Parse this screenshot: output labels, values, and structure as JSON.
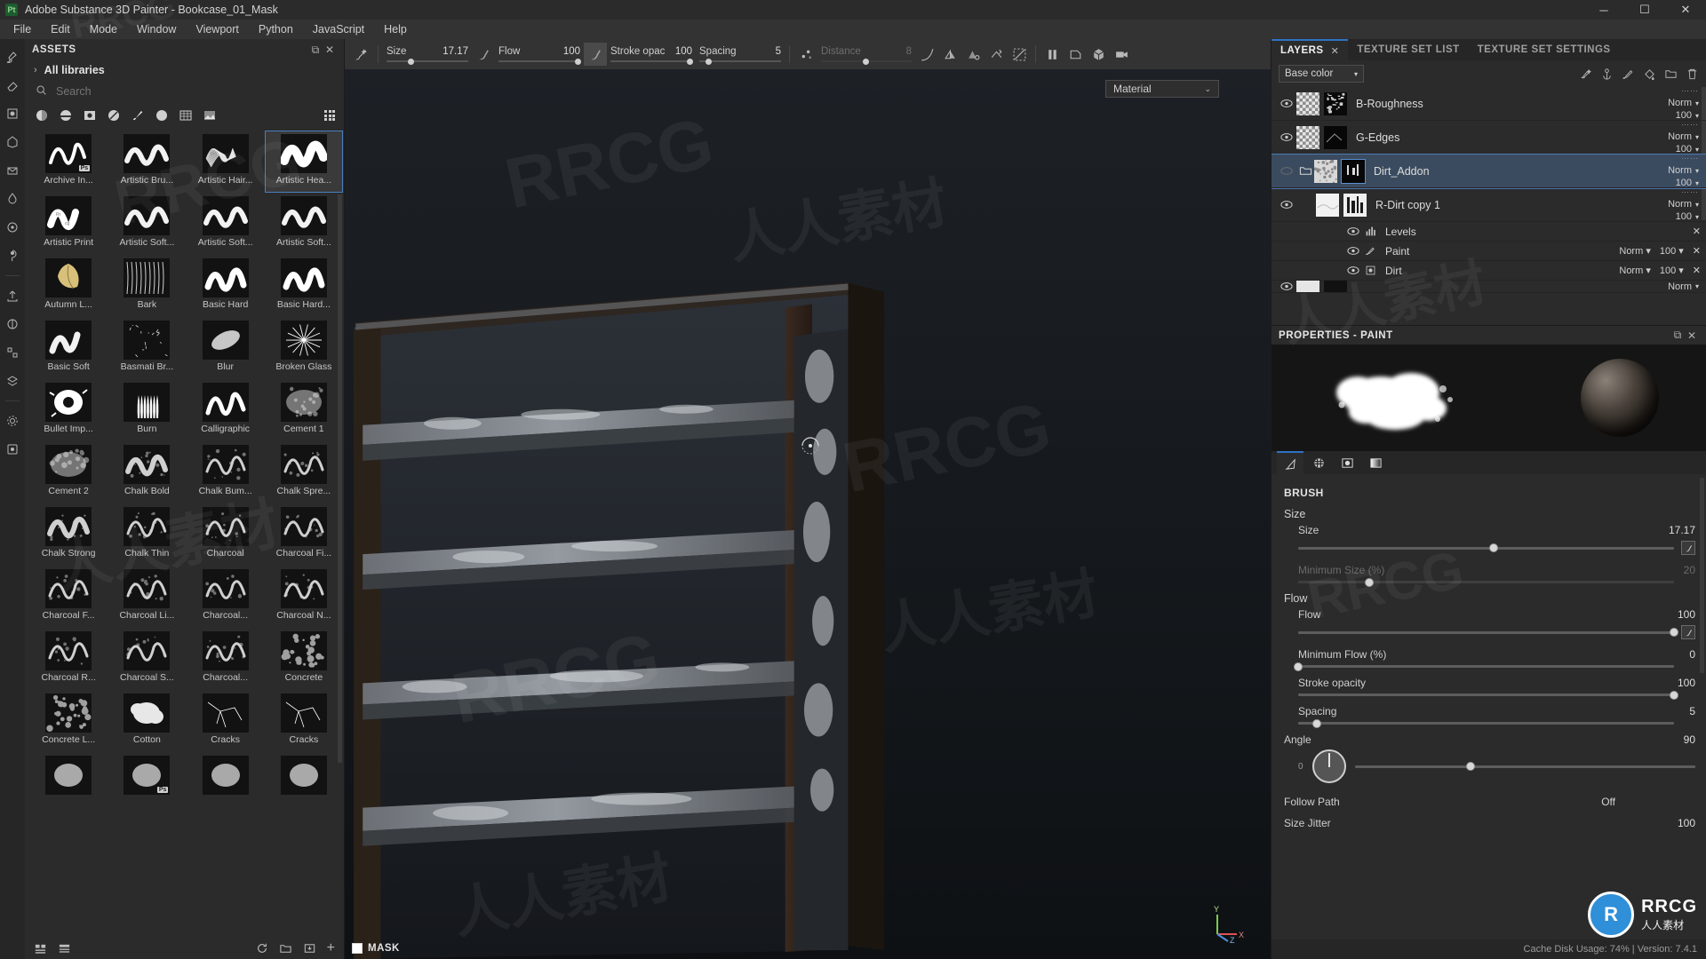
{
  "titlebar": {
    "app_icon": "photoshop-style-pt-icon",
    "title": "Adobe Substance 3D Painter - Bookcase_01_Mask",
    "minimize": "─",
    "maximize": "☐",
    "close": "✕"
  },
  "menubar": {
    "items": [
      "File",
      "Edit",
      "Mode",
      "Window",
      "Viewport",
      "Python",
      "JavaScript",
      "Help"
    ]
  },
  "left_rail": {
    "icons": [
      "brush-icon",
      "eraser-icon",
      "projection-icon",
      "geometry-fill-icon",
      "polygon-fill-icon",
      "smudge-icon",
      "clone-icon",
      "material-picker-icon",
      "export-icon",
      "bake-icon",
      "generator-icon",
      "layer-stack-icon",
      "settings-icon",
      "plugin-icon"
    ]
  },
  "assets": {
    "panel_title": "ASSETS",
    "float_icon": "⧉",
    "close_icon": "✕",
    "library_label": "All libraries",
    "chevron": "›",
    "search_placeholder": "Search",
    "search_value": "",
    "filters": [
      "material-filter",
      "smart-material-filter",
      "mask-filter",
      "smart-mask-filter",
      "brush-filter",
      "alpha-filter",
      "texture-filter",
      "environment-filter"
    ],
    "grid_view_icon": "grid-view-icon",
    "items": [
      {
        "name": "Archive In...",
        "type": "stroke-thin",
        "badge": "Ps",
        "selected": false
      },
      {
        "name": "Artistic Bru...",
        "type": "stroke-soft",
        "badge": "",
        "selected": false
      },
      {
        "name": "Artistic Hair...",
        "type": "stroke-hair",
        "badge": "",
        "selected": false
      },
      {
        "name": "Artistic Hea...",
        "type": "stroke-heavy",
        "badge": "",
        "selected": true
      },
      {
        "name": "Artistic Print",
        "type": "stroke-print",
        "badge": "",
        "selected": false
      },
      {
        "name": "Artistic Soft...",
        "type": "stroke-soft2",
        "badge": "",
        "selected": false
      },
      {
        "name": "Artistic Soft...",
        "type": "stroke-soft3",
        "badge": "",
        "selected": false
      },
      {
        "name": "Artistic Soft...",
        "type": "stroke-soft4",
        "badge": "",
        "selected": false
      },
      {
        "name": "Autumn L...",
        "type": "leaf",
        "badge": "",
        "selected": false
      },
      {
        "name": "Bark",
        "type": "bark",
        "badge": "",
        "selected": false
      },
      {
        "name": "Basic Hard",
        "type": "basic-hard",
        "badge": "",
        "selected": false
      },
      {
        "name": "Basic Hard...",
        "type": "basic-hard2",
        "badge": "",
        "selected": false
      },
      {
        "name": "Basic Soft",
        "type": "basic-soft",
        "badge": "",
        "selected": false
      },
      {
        "name": "Basmati Br...",
        "type": "basmati",
        "badge": "",
        "selected": false
      },
      {
        "name": "Blur",
        "type": "blur",
        "badge": "",
        "selected": false
      },
      {
        "name": "Broken Glass",
        "type": "broken-glass",
        "badge": "",
        "selected": false
      },
      {
        "name": "Bullet Imp...",
        "type": "bullet",
        "badge": "",
        "selected": false
      },
      {
        "name": "Burn",
        "type": "burn",
        "badge": "",
        "selected": false
      },
      {
        "name": "Calligraphic",
        "type": "calligraphic",
        "badge": "",
        "selected": false
      },
      {
        "name": "Cement 1",
        "type": "cement1",
        "badge": "",
        "selected": false
      },
      {
        "name": "Cement 2",
        "type": "cement2",
        "badge": "",
        "selected": false
      },
      {
        "name": "Chalk Bold",
        "type": "chalk-bold",
        "badge": "",
        "selected": false
      },
      {
        "name": "Chalk Bum...",
        "type": "chalk-bump",
        "badge": "",
        "selected": false
      },
      {
        "name": "Chalk Spre...",
        "type": "chalk-spread",
        "badge": "",
        "selected": false
      },
      {
        "name": "Chalk Strong",
        "type": "chalk-strong",
        "badge": "",
        "selected": false
      },
      {
        "name": "Chalk Thin",
        "type": "chalk-thin",
        "badge": "",
        "selected": false
      },
      {
        "name": "Charcoal",
        "type": "charcoal",
        "badge": "",
        "selected": false
      },
      {
        "name": "Charcoal Fi...",
        "type": "charcoal-fine",
        "badge": "",
        "selected": false
      },
      {
        "name": "Charcoal F...",
        "type": "charcoal-f",
        "badge": "",
        "selected": false
      },
      {
        "name": "Charcoal Li...",
        "type": "charcoal-li",
        "badge": "",
        "selected": false
      },
      {
        "name": "Charcoal...",
        "type": "charcoal-3",
        "badge": "",
        "selected": false
      },
      {
        "name": "Charcoal N...",
        "type": "charcoal-n",
        "badge": "",
        "selected": false
      },
      {
        "name": "Charcoal R...",
        "type": "charcoal-r",
        "badge": "",
        "selected": false
      },
      {
        "name": "Charcoal S...",
        "type": "charcoal-s",
        "badge": "",
        "selected": false
      },
      {
        "name": "Charcoal...",
        "type": "charcoal-4",
        "badge": "",
        "selected": false
      },
      {
        "name": "Concrete",
        "type": "concrete",
        "badge": "",
        "selected": false
      },
      {
        "name": "Concrete L...",
        "type": "concrete-l",
        "badge": "",
        "selected": false
      },
      {
        "name": "Cotton",
        "type": "cotton",
        "badge": "",
        "selected": false
      },
      {
        "name": "Cracks",
        "type": "cracks",
        "badge": "",
        "selected": false
      },
      {
        "name": "Cracks",
        "type": "cracks2",
        "badge": "",
        "selected": false
      },
      {
        "name": "",
        "type": "row11a",
        "badge": "",
        "selected": false
      },
      {
        "name": "",
        "type": "row11b",
        "badge": "Ps",
        "selected": false
      },
      {
        "name": "",
        "type": "row11c",
        "badge": "",
        "selected": false
      },
      {
        "name": "",
        "type": "row11d",
        "badge": "",
        "selected": false
      }
    ],
    "footer_icons": [
      "list-view-icon",
      "shelf-icon",
      "refresh-icon",
      "folder-icon",
      "import-icon",
      "add-icon"
    ]
  },
  "toolbar": {
    "tool_icons": [
      "brush-cursor-icon",
      "close-tool-icon",
      "symmetry-icon"
    ],
    "params": [
      {
        "label": "Size",
        "value": "17.17",
        "knob_pct": 26,
        "dim": false,
        "pen": true
      },
      {
        "label": "Flow",
        "value": "100",
        "knob_pct": 94,
        "dim": false,
        "pen": true
      },
      {
        "label": "Stroke opac",
        "value": "100",
        "knob_pct": 94,
        "dim": false,
        "pen": false
      },
      {
        "label": "Spacing",
        "value": "5",
        "knob_pct": 8,
        "dim": false,
        "pen": false
      },
      {
        "label": "Distance",
        "value": "8",
        "knob_pct": 46,
        "dim": true,
        "pen": false
      }
    ],
    "right_icons": [
      "curve-icon",
      "mirror-icon",
      "mirror-plane-icon",
      "flip-icon",
      "no-symmetry-icon",
      "pause-icon",
      "camera-view-icon",
      "cube-3d-icon",
      "render-icon"
    ]
  },
  "viewport": {
    "material_dropdown": "Material",
    "dropdown_caret": "⌄",
    "mask_label": "MASK",
    "axis_labels": {
      "x": "X",
      "y": "Y",
      "z": "Z"
    }
  },
  "right_dock": {
    "tabs": [
      {
        "label": "LAYERS",
        "active": true,
        "closable": true,
        "close": "✕"
      },
      {
        "label": "TEXTURE SET LIST",
        "active": false,
        "closable": false
      },
      {
        "label": "TEXTURE SET SETTINGS",
        "active": false,
        "closable": false
      }
    ],
    "channel_dropdown": "Base color",
    "layer_tool_icons": [
      "add-effect-icon",
      "anchor-icon",
      "paint-layer-icon",
      "fill-layer-icon",
      "folder-icon",
      "trash-icon"
    ],
    "layers": [
      {
        "name": "B-Roughness",
        "visible": true,
        "selected": false,
        "blend": "Norm",
        "opacity": "100",
        "has_folder": false,
        "thumbs": [
          "checker",
          "mask-dark"
        ],
        "indent": 0
      },
      {
        "name": "G-Edges",
        "visible": true,
        "selected": false,
        "blend": "Norm",
        "opacity": "100",
        "has_folder": false,
        "thumbs": [
          "checker",
          "mask-black"
        ],
        "indent": 0
      },
      {
        "name": "Dirt_Addon",
        "visible": false,
        "selected": true,
        "blend": "Norm",
        "opacity": "100",
        "has_folder": true,
        "thumbs": [
          "noise-white",
          "mask-sel"
        ],
        "indent": 0
      },
      {
        "name": "R-Dirt copy 1",
        "visible": true,
        "selected": false,
        "blend": "Norm",
        "opacity": "100",
        "has_folder": false,
        "thumbs": [
          "white-soft",
          "mask-bars"
        ],
        "indent": 1
      }
    ],
    "effects": [
      {
        "name": "Levels",
        "icon": "levels-icon",
        "blend": "",
        "opacity": "",
        "close": "✕"
      },
      {
        "name": "Paint",
        "icon": "paint-icon",
        "blend": "Norm",
        "opacity": "100",
        "close": "✕"
      },
      {
        "name": "Dirt",
        "icon": "dirt-icon",
        "blend": "Norm",
        "opacity": "100",
        "close": "✕"
      }
    ],
    "partial_row_blend": "Norm"
  },
  "properties": {
    "panel_title": "PROPERTIES - PAINT",
    "float_icon": "⧉",
    "close_icon": "✕",
    "tabs": [
      "brush-tab",
      "alpha-tab",
      "stencil-tab",
      "gradient-tab"
    ],
    "section": "BRUSH",
    "groups": [
      {
        "title": "Size",
        "rows": [
          {
            "label": "Size",
            "value": "17.17",
            "knob_pct": 52,
            "dim": false,
            "pen": true,
            "hollow": false
          },
          {
            "label": "Minimum Size (%)",
            "value": "20",
            "knob_pct": 19,
            "dim": true,
            "pen": false,
            "hollow": false
          }
        ]
      },
      {
        "title": "Flow",
        "rows": [
          {
            "label": "Flow",
            "value": "100",
            "knob_pct": 100,
            "dim": false,
            "pen": true,
            "hollow": false
          },
          {
            "label": "Minimum Flow (%)",
            "value": "0",
            "knob_pct": 0,
            "dim": false,
            "pen": false,
            "hollow": false
          }
        ]
      },
      {
        "title": "",
        "rows": [
          {
            "label": "Stroke opacity",
            "value": "100",
            "knob_pct": 100,
            "dim": false,
            "pen": false,
            "hollow": false
          },
          {
            "label": "Spacing",
            "value": "5",
            "knob_pct": 5,
            "dim": false,
            "pen": false,
            "hollow": false
          }
        ]
      }
    ],
    "angle": {
      "label": "Angle",
      "value": "90",
      "zero_label": "0",
      "knob_pct": 34
    },
    "follow_path": {
      "label": "Follow Path",
      "value": "Off"
    },
    "size_jitter": {
      "label": "Size Jitter",
      "value": "100"
    }
  },
  "statusbar": {
    "text": "Cache Disk Usage: 74% | Version: 7.4.1"
  },
  "watermarks": {
    "latin": "RRCG",
    "cn": "人人素材",
    "logo_letter": "R",
    "logo_name": "RRCG",
    "logo_sub": "人人素材"
  }
}
